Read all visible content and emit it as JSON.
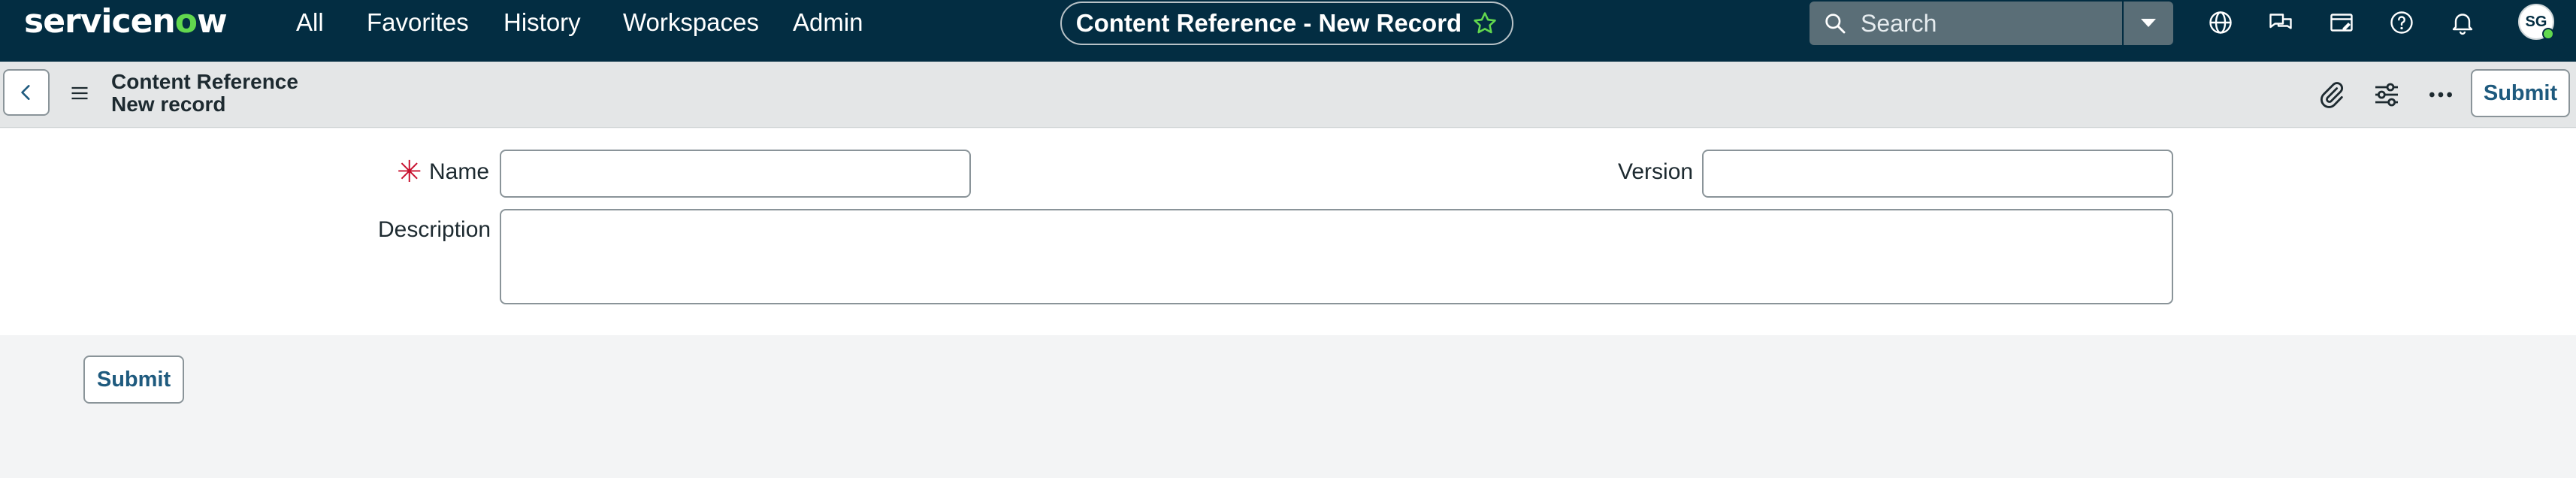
{
  "topnav": {
    "logo": {
      "prefix": "servicen",
      "o": "o",
      "suffix": "w"
    },
    "links": [
      "All",
      "Favorites",
      "History",
      "Workspaces",
      "Admin"
    ],
    "record_title": "Content Reference - New Record",
    "search_placeholder": "Search",
    "user_initials": "SG"
  },
  "header": {
    "title": "Content Reference",
    "subtitle": "New record",
    "submit_label": "Submit"
  },
  "form": {
    "required_marker": "✳",
    "name_label": "Name",
    "name_value": "",
    "version_label": "Version",
    "version_value": "",
    "description_label": "Description",
    "description_value": ""
  },
  "footer": {
    "submit_label": "Submit"
  },
  "colors": {
    "nav_bg": "#032d42",
    "accent_green": "#62d84e",
    "required_red": "#c8102e",
    "button_text": "#1e5a7e"
  }
}
